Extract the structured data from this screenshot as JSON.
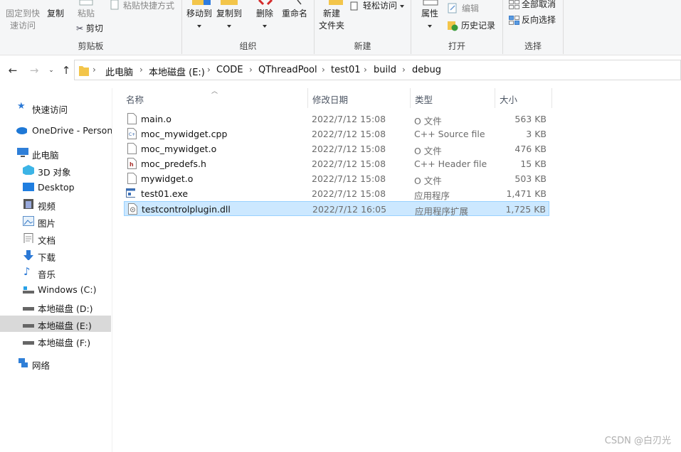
{
  "ribbon": {
    "clipboard": {
      "pin_label_line1": "固定到快",
      "pin_label_line2": "速访问",
      "copy_label": "复制",
      "paste_label": "粘贴",
      "paste_shortcut_label": "粘贴快捷方式",
      "cut_label": "剪切",
      "group_label": "剪贴板"
    },
    "organize": {
      "move_to_label": "移动到",
      "copy_to_label": "复制到",
      "delete_label": "删除",
      "rename_label": "重命名",
      "group_label": "组织"
    },
    "new": {
      "new_folder_line1": "新建",
      "new_folder_line2": "文件夹",
      "easy_access_label": "轻松访问",
      "group_label": "新建"
    },
    "open": {
      "properties_label": "属性",
      "edit_label": "编辑",
      "history_label": "历史记录",
      "group_label": "打开"
    },
    "select": {
      "select_none_label": "全部取消",
      "invert_selection_label": "反向选择",
      "group_label": "选择"
    }
  },
  "address": {
    "crumbs": [
      "此电脑",
      "本地磁盘 (E:)",
      "CODE",
      "QThreadPool",
      "test01",
      "build",
      "debug"
    ]
  },
  "nav_pane": {
    "items": [
      {
        "label": "快速访问",
        "icon": "star-icon"
      },
      {
        "label": "OneDrive - Persona",
        "icon": "cloud-icon"
      },
      {
        "label": "此电脑",
        "icon": "computer-icon"
      },
      {
        "label": "3D 对象",
        "icon": "cube-icon"
      },
      {
        "label": "Desktop",
        "icon": "desktop-icon"
      },
      {
        "label": "视频",
        "icon": "video-icon"
      },
      {
        "label": "图片",
        "icon": "pictures-icon"
      },
      {
        "label": "文档",
        "icon": "documents-icon"
      },
      {
        "label": "下载",
        "icon": "download-icon"
      },
      {
        "label": "音乐",
        "icon": "music-icon"
      },
      {
        "label": "Windows (C:)",
        "icon": "drive-icon"
      },
      {
        "label": "本地磁盘 (D:)",
        "icon": "drive-icon"
      },
      {
        "label": "本地磁盘 (E:)",
        "icon": "drive-icon",
        "selected": true
      },
      {
        "label": "本地磁盘 (F:)",
        "icon": "drive-icon"
      },
      {
        "label": "网络",
        "icon": "network-icon"
      }
    ]
  },
  "file_list": {
    "columns": {
      "name": "名称",
      "modified": "修改日期",
      "type": "类型",
      "size": "大小"
    },
    "rows": [
      {
        "name": "main.o",
        "modified": "2022/7/12 15:08",
        "type": "O 文件",
        "size": "563 KB",
        "icon": "blank-file-icon"
      },
      {
        "name": "moc_mywidget.cpp",
        "modified": "2022/7/12 15:08",
        "type": "C++ Source file",
        "size": "3 KB",
        "icon": "cpp-file-icon"
      },
      {
        "name": "moc_mywidget.o",
        "modified": "2022/7/12 15:08",
        "type": "O 文件",
        "size": "476 KB",
        "icon": "blank-file-icon"
      },
      {
        "name": "moc_predefs.h",
        "modified": "2022/7/12 15:08",
        "type": "C++ Header file",
        "size": "15 KB",
        "icon": "header-file-icon"
      },
      {
        "name": "mywidget.o",
        "modified": "2022/7/12 15:08",
        "type": "O 文件",
        "size": "503 KB",
        "icon": "blank-file-icon"
      },
      {
        "name": "test01.exe",
        "modified": "2022/7/12 15:08",
        "type": "应用程序",
        "size": "1,471 KB",
        "icon": "exe-file-icon"
      },
      {
        "name": "testcontrolplugin.dll",
        "modified": "2022/7/12 16:05",
        "type": "应用程序扩展",
        "size": "1,725 KB",
        "icon": "dll-file-icon",
        "selected": true
      }
    ]
  },
  "watermark": "CSDN @白刃光"
}
